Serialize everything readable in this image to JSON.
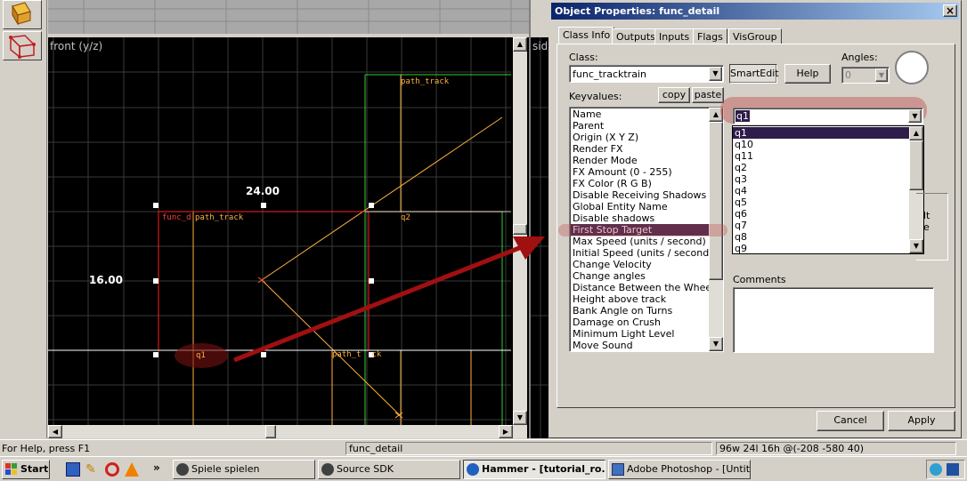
{
  "viewport_front": {
    "label": "front (y/z)",
    "dimension_width": "24.00",
    "dimension_height": "16.00",
    "entity_labels": {
      "func_detail_track": "func_d",
      "path_track_overlap": "path_track",
      "path_track_top": "path_track",
      "q2": "q2",
      "q1": "q1",
      "path_track_bottom": "path_t",
      "path_track_bottom_suffix": "ck"
    }
  },
  "sideview": {
    "label": "sid"
  },
  "dialog": {
    "title": "Object Properties: func_detail",
    "close_symbol": "×",
    "tabs": [
      "Class Info",
      "Outputs",
      "Inputs",
      "Flags",
      "VisGroup"
    ],
    "class_label": "Class:",
    "class_value": "func_tracktrain",
    "smartedit_label": "SmartEdit",
    "help_label": "Help",
    "angles_label": "Angles:",
    "angles_value": "0",
    "keyvalues_label": "Keyvalues:",
    "copy_label": "copy",
    "paste_label": "paste",
    "keyvalues": [
      "Name",
      "Parent",
      "Origin (X Y Z)",
      "Render FX",
      "Render Mode",
      "FX Amount (0 - 255)",
      "FX Color (R G B)",
      "Disable Receiving Shadows",
      "Global Entity Name",
      "Disable shadows",
      "First Stop Target",
      "Max Speed (units / second)",
      "Initial Speed (units / second)",
      "Change Velocity",
      "Change angles",
      "Distance Between the Wheels",
      "Height above track",
      "Bank Angle on Turns",
      "Damage on Crush",
      "Minimum Light Level",
      "Move Sound"
    ],
    "selected_keyvalue": "First Stop Target",
    "value_combo": "q1",
    "dropdown_options": [
      "q1",
      "q10",
      "q11",
      "q2",
      "q3",
      "q4",
      "q5",
      "q6",
      "q7",
      "q8",
      "q9"
    ],
    "dropdown_selected": "q1",
    "partial_text_1": "lt",
    "partial_text_2": "e",
    "comments_label": "Comments",
    "cancel_label": "Cancel",
    "apply_label": "Apply"
  },
  "statusbar": {
    "help_text": "For Help, press F1",
    "selection": "func_detail",
    "dimensions": "96w 24l 16h @(-208 -580 40)"
  },
  "taskbar": {
    "start_label": "Start",
    "tasks": [
      {
        "label": "Spiele spielen",
        "active": false
      },
      {
        "label": "Source SDK",
        "active": false
      },
      {
        "label": "Hammer - [tutorial_ro...",
        "active": true
      },
      {
        "label": "Adobe Photoshop - [Untitl...",
        "active": false
      }
    ],
    "expand_symbol": "»"
  },
  "colors": {
    "selection_red": "#ff2020",
    "path_yellow": "#ffb040",
    "grid_line": "#3a3a3a",
    "highlight_green": "#40ff40",
    "annotation_arrow": "#a01010",
    "list_selection": "#2e1c4a"
  }
}
